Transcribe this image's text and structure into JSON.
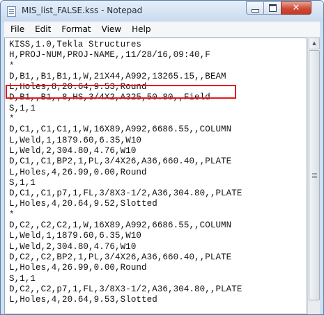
{
  "window": {
    "title": "MIS_list_FALSE.kss - Notepad",
    "close_glyph": "✕"
  },
  "menu": [
    "File",
    "Edit",
    "Format",
    "View",
    "Help"
  ],
  "content_lines": [
    "KISS,1.0,Tekla Structures",
    "H,PROJ-NUM,PROJ-NAME,,11/28/16,09:40,F",
    "*",
    "D,B1,,B1,B1,1,W,21X44,A992,13265.15,,BEAM",
    "L,Holes,8,20.64,9.53,Round",
    "D,B1,,B1,,8,HS,3/4X2,A325,50.80,,Field",
    "S,1,1",
    "*",
    "D,C1,,C1,C1,1,W,16X89,A992,6686.55,,COLUMN",
    "L,Weld,1,1879.60,6.35,W10",
    "L,Weld,2,304.80,4.76,W10",
    "D,C1,,C1,BP2,1,PL,3/4X26,A36,660.40,,PLATE",
    "L,Holes,4,26.99,0.00,Round",
    "S,1,1",
    "D,C1,,C1,p7,1,FL,3/8X3-1/2,A36,304.80,,PLATE",
    "L,Holes,4,20.64,9.52,Slotted",
    "*",
    "D,C2,,C2,C2,1,W,16X89,A992,6686.55,,COLUMN",
    "L,Weld,1,1879.60,6.35,W10",
    "L,Weld,2,304.80,4.76,W10",
    "D,C2,,C2,BP2,1,PL,3/4X26,A36,660.40,,PLATE",
    "L,Holes,4,26.99,0.00,Round",
    "S,1,1",
    "D,C2,,C2,p7,1,FL,3/8X3-1/2,A36,304.80,,PLATE",
    "L,Holes,4,20.64,9.53,Slotted"
  ],
  "highlighted_line_index": 5,
  "colors": {
    "highlight_border": "#e0181b",
    "close_button": "#c23a26"
  },
  "icons": {
    "app": "notepad-icon",
    "minimize": "minimize-icon",
    "maximize": "maximize-icon",
    "close": "close-icon",
    "scroll_up": "scroll-up-arrow-icon"
  }
}
